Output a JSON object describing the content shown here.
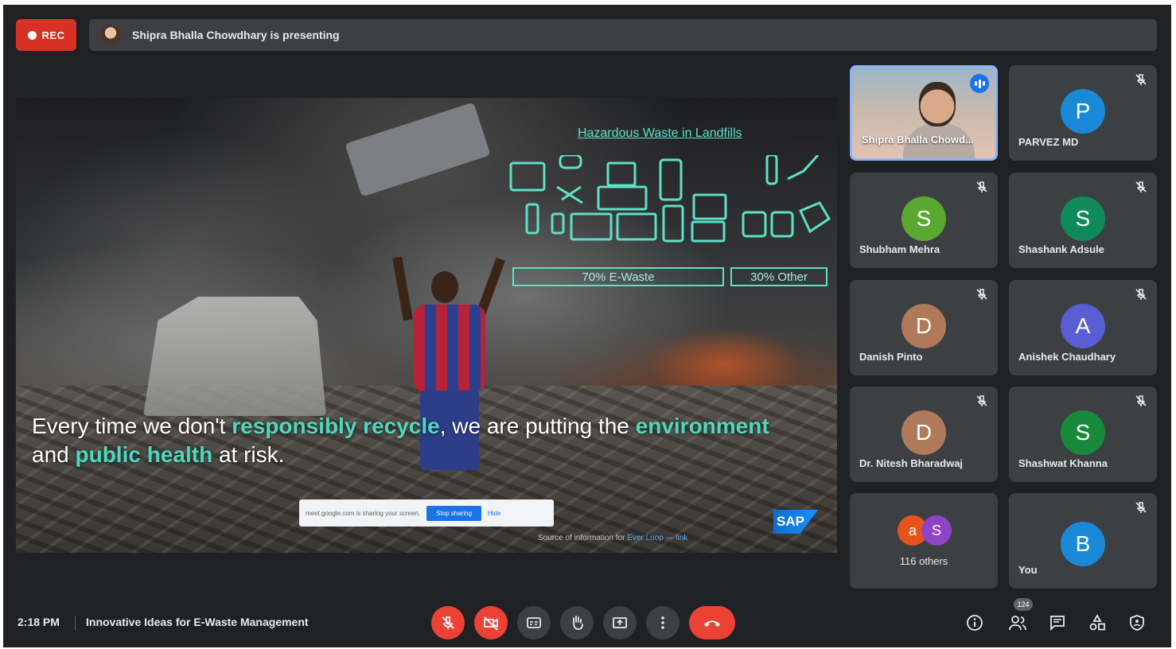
{
  "recording": {
    "label": "REC"
  },
  "presenting_bar": {
    "text": "Shipra Bhalla Chowdhary is presenting"
  },
  "slide": {
    "title": "Hazardous Waste in Landfills",
    "label_ewaste": "70% E-Waste",
    "label_other": "30% Other",
    "caption": {
      "part1": "Every time we don't ",
      "hl1": "responsibly recycle",
      "part2": ", we are putting the ",
      "hl2": "environment",
      "part3": " and ",
      "hl3": "public health",
      "part4": " at risk."
    },
    "share_notice": {
      "text": "meet.google.com is sharing your screen.",
      "stop_button": "Stop sharing",
      "hide_link": "Hide"
    },
    "logo": "SAP",
    "source": {
      "text": "Source of information for ",
      "link": "Ever Loop — link"
    }
  },
  "participants": [
    {
      "name": "Shipra Bhalla Chowd...",
      "initial": "",
      "color": "",
      "speaking": true
    },
    {
      "name": "PARVEZ MD",
      "initial": "P",
      "color": "#1a8ad8"
    },
    {
      "name": "Shubham Mehra",
      "initial": "S",
      "color": "#5aa832"
    },
    {
      "name": "Shashank Adsule",
      "initial": "S",
      "color": "#0f8a5a"
    },
    {
      "name": "Danish Pinto",
      "initial": "D",
      "color": "#b07a5a"
    },
    {
      "name": "Anishek Chaudhary",
      "initial": "A",
      "color": "#5a5ed4"
    },
    {
      "name": "Dr. Nitesh Bharadwaj",
      "initial": "D",
      "color": "#b07a5a"
    },
    {
      "name": "Shashwat Khanna",
      "initial": "S",
      "color": "#198a3c"
    },
    {
      "name": "You",
      "initial": "B",
      "color": "#1a8ad8"
    }
  ],
  "others": {
    "label": "116 others",
    "a1": "a",
    "a2": "S"
  },
  "bottom": {
    "time": "2:18 PM",
    "meeting_title": "Innovative Ideas for E-Waste Management",
    "participant_count": "124"
  },
  "colors": {
    "accent": "#4ed8bc",
    "danger": "#ea4335",
    "surface": "#3c4043",
    "bg": "#202124"
  }
}
